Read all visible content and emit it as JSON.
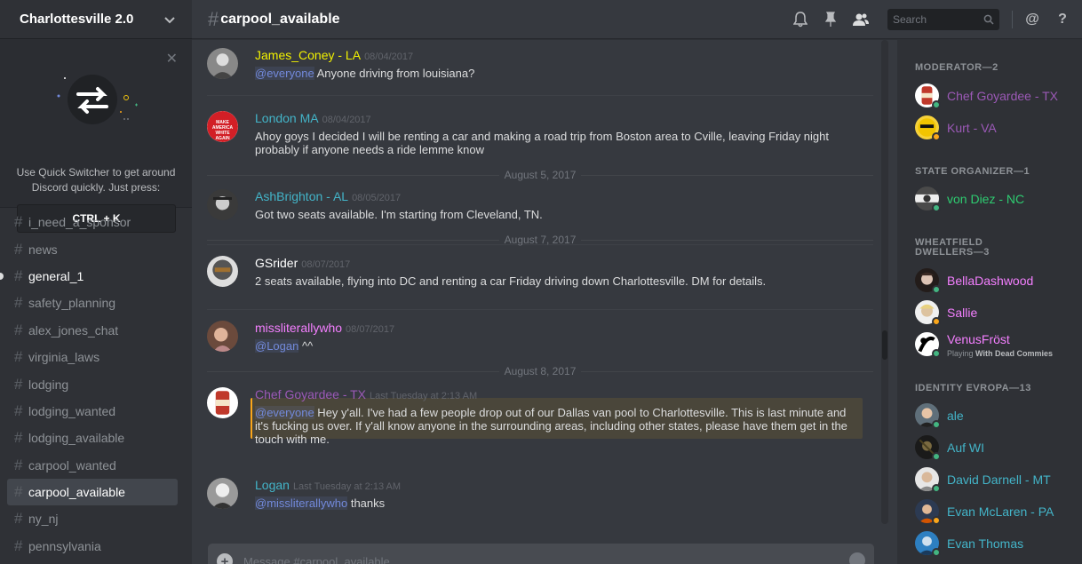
{
  "server": {
    "name": "Charlottesville 2.0"
  },
  "quick_switcher": {
    "text": "Use Quick Switcher to get around Discord quickly. Just press:",
    "shortcut": "CTRL + K"
  },
  "channels": [
    {
      "name": "i_need_a_sponsor"
    },
    {
      "name": "news"
    },
    {
      "name": "general_1"
    },
    {
      "name": "safety_planning"
    },
    {
      "name": "alex_jones_chat"
    },
    {
      "name": "virginia_laws"
    },
    {
      "name": "lodging"
    },
    {
      "name": "lodging_wanted"
    },
    {
      "name": "lodging_available"
    },
    {
      "name": "carpool_wanted"
    },
    {
      "name": "carpool_available"
    },
    {
      "name": "ny_nj"
    },
    {
      "name": "pennsylvania"
    }
  ],
  "header": {
    "hash": "#",
    "channel": "carpool_available",
    "search_placeholder": "Search"
  },
  "messages": [
    {
      "author": "James_Coney - LA",
      "time": "08/04/2017",
      "mention": "@everyone",
      "text": " Anyone driving from louisiana?",
      "color": "#f1f100"
    },
    {
      "author": "London MA",
      "time": "08/04/2017",
      "text": "Ahoy goys I decided I will be renting a car and making a road trip from Boston area to Cville, leaving Friday night probably if anyone needs a ride lemme know",
      "color": "#43b4c8",
      "avatar_text": "MAKE AMERICA WHITE AGAIN"
    },
    {
      "author": "AshBrighton - AL",
      "time": "08/05/2017",
      "text": "Got two seats available. I'm starting from Cleveland, TN.",
      "color": "#43b4c8"
    },
    {
      "author": "GSrider",
      "time": "08/07/2017",
      "text": "2 seats available, flying into DC and renting a car Friday driving down Charlottesville. DM for details.",
      "color": "#ffffff"
    },
    {
      "author": "missliterallywho",
      "time": "08/07/2017",
      "mention": "@Logan",
      "text": " ^^",
      "color": "#f47fff"
    },
    {
      "author": "Chef Goyardee - TX",
      "time": "Last Tuesday at 2:13 AM",
      "mention": "@everyone",
      "text": "  Hey y'all. I've had a few people drop out of our Dallas van pool to Charlottesville. This is last minute and it's fucking us over. If y'all know anyone in the surrounding areas, including other states, please have them get in the touch with me.",
      "color": "#9b59b6"
    },
    {
      "author": "Logan",
      "time": "Last Tuesday at 2:13 AM",
      "mention": "@missliterallywho",
      "text": " thanks",
      "color": "#43b4c8"
    }
  ],
  "date_separators": [
    "August 5, 2017",
    "August 7, 2017",
    "August 8, 2017"
  ],
  "composer": {
    "placeholder": "Message #carpool_available",
    "plus": "+"
  },
  "members": {
    "roles": [
      {
        "name": "MODERATOR—2"
      },
      {
        "name": "STATE ORGANIZER—1"
      },
      {
        "name": "WHEATFIELD DWELLERS—3"
      },
      {
        "name": "IDENTITY EVROPA—13"
      }
    ],
    "people": [
      {
        "name": "Chef Goyardee - TX",
        "color": "#9b59b6",
        "status": "#43b581"
      },
      {
        "name": "Kurt - VA",
        "color": "#9b59b6",
        "status": "#faa61a"
      },
      {
        "name": "von Diez - NC",
        "color": "#2ecc71",
        "status": "#43b581"
      },
      {
        "name": "BellaDashwood",
        "color": "#f47fff",
        "status": "#43b581"
      },
      {
        "name": "Sallie",
        "color": "#f47fff",
        "status": "#faa61a"
      },
      {
        "name": "VenusFröst",
        "color": "#f47fff",
        "status": "#43b581",
        "activity_prefix": "Playing ",
        "activity": "With Dead Commies"
      },
      {
        "name": "ale",
        "color": "#43b4c8",
        "status": "#43b581"
      },
      {
        "name": "Auf WI",
        "color": "#43b4c8",
        "status": "#43b581"
      },
      {
        "name": "David Darnell - MT",
        "color": "#43b4c8",
        "status": "#43b581"
      },
      {
        "name": "Evan McLaren - PA",
        "color": "#43b4c8",
        "status": "#faa61a"
      },
      {
        "name": "Evan Thomas",
        "color": "#43b4c8",
        "status": "#43b581"
      }
    ]
  }
}
